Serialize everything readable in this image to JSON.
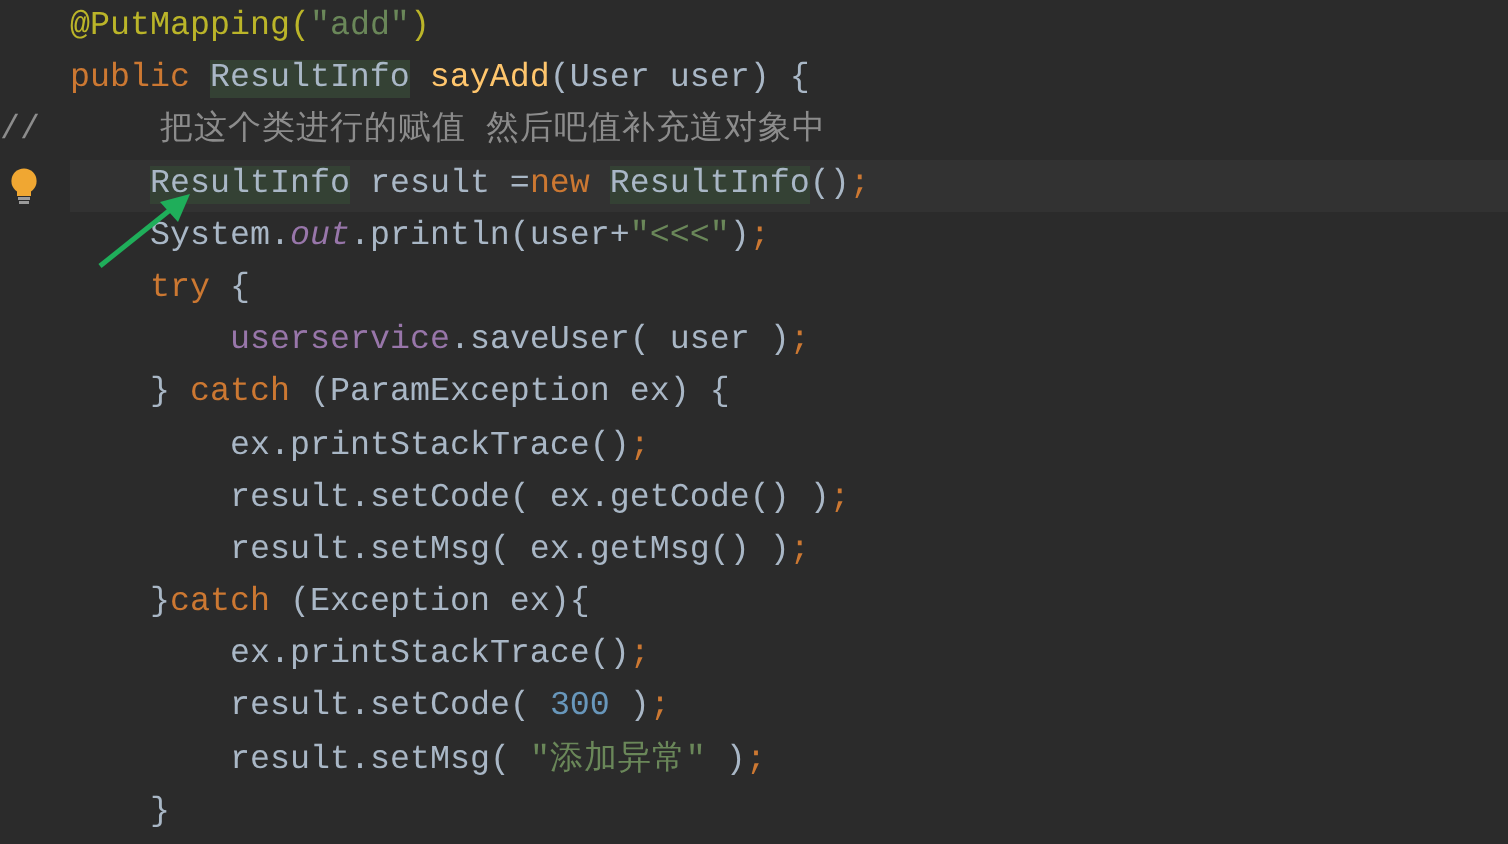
{
  "editor": {
    "lines": [
      {
        "kind": "code",
        "tokens": [
          {
            "kind": "annotation",
            "text": "@PutMapping("
          },
          {
            "kind": "string",
            "text": "\"add\""
          },
          {
            "kind": "annotation",
            "text": ")"
          }
        ]
      },
      {
        "kind": "code",
        "tokens": [
          {
            "kind": "keyword",
            "text": "public "
          },
          {
            "kind": "type_highlight",
            "text": "ResultInfo"
          },
          {
            "kind": "method_decl",
            "text": " sayAdd"
          },
          {
            "kind": "plain",
            "text": "(User user) {"
          }
        ],
        "children": [
          {
            "kind": "line_comment",
            "tokens": [
              {
                "kind": "comment",
                "text": "//      把这个类进行的赋值 然后吧值补充道对象中"
              }
            ]
          },
          {
            "kind": "code",
            "current": true,
            "intention": true,
            "tokens": [
              {
                "kind": "type_highlight",
                "text": "ResultInfo"
              },
              {
                "kind": "plain",
                "text": " result ="
              },
              {
                "kind": "keyword",
                "text": "new "
              },
              {
                "kind": "type_highlight",
                "text": "ResultInfo"
              },
              {
                "kind": "plain",
                "text": "()"
              },
              {
                "kind": "keyword",
                "text": ";"
              }
            ]
          },
          {
            "kind": "code",
            "tokens": [
              {
                "kind": "plain",
                "text": "System."
              },
              {
                "kind": "static_field",
                "text": "out"
              },
              {
                "kind": "plain",
                "text": ".println(user+"
              },
              {
                "kind": "string",
                "text": "\"<<<\""
              },
              {
                "kind": "plain",
                "text": ")"
              },
              {
                "kind": "keyword",
                "text": ";"
              }
            ]
          },
          {
            "kind": "code",
            "tokens": [
              {
                "kind": "keyword",
                "text": "try"
              },
              {
                "kind": "plain",
                "text": " {"
              }
            ],
            "children": [
              {
                "kind": "code",
                "tokens": [
                  {
                    "kind": "field",
                    "text": "userservice"
                  },
                  {
                    "kind": "plain",
                    "text": ".saveUser( user )"
                  },
                  {
                    "kind": "keyword",
                    "text": ";"
                  }
                ]
              }
            ]
          },
          {
            "kind": "code",
            "tokens": [
              {
                "kind": "plain",
                "text": "} "
              },
              {
                "kind": "keyword",
                "text": "catch"
              },
              {
                "kind": "plain",
                "text": " (ParamException ex) {"
              }
            ],
            "children": [
              {
                "kind": "code",
                "tokens": [
                  {
                    "kind": "plain",
                    "text": "ex.printStackTrace()"
                  },
                  {
                    "kind": "keyword",
                    "text": ";"
                  }
                ]
              },
              {
                "kind": "code",
                "tokens": [
                  {
                    "kind": "plain",
                    "text": "result.setCode( ex.getCode() )"
                  },
                  {
                    "kind": "keyword",
                    "text": ";"
                  }
                ]
              },
              {
                "kind": "code",
                "tokens": [
                  {
                    "kind": "plain",
                    "text": "result.setMsg( ex.getMsg() )"
                  },
                  {
                    "kind": "keyword",
                    "text": ";"
                  }
                ]
              }
            ]
          },
          {
            "kind": "code",
            "tokens": [
              {
                "kind": "plain",
                "text": "}"
              },
              {
                "kind": "keyword",
                "text": "catch"
              },
              {
                "kind": "plain",
                "text": " (Exception ex){"
              }
            ],
            "children": [
              {
                "kind": "code",
                "tokens": [
                  {
                    "kind": "plain",
                    "text": "ex.printStackTrace()"
                  },
                  {
                    "kind": "keyword",
                    "text": ";"
                  }
                ]
              },
              {
                "kind": "code",
                "tokens": [
                  {
                    "kind": "plain",
                    "text": "result.setCode( "
                  },
                  {
                    "kind": "number",
                    "text": "300"
                  },
                  {
                    "kind": "plain",
                    "text": " )"
                  },
                  {
                    "kind": "keyword",
                    "text": ";"
                  }
                ]
              },
              {
                "kind": "code",
                "tokens": [
                  {
                    "kind": "plain",
                    "text": "result.setMsg( "
                  },
                  {
                    "kind": "string",
                    "text": "\"添加异常\""
                  },
                  {
                    "kind": "plain",
                    "text": " )"
                  },
                  {
                    "kind": "keyword",
                    "text": ";"
                  }
                ]
              }
            ]
          },
          {
            "kind": "code",
            "tokens": [
              {
                "kind": "plain",
                "text": "}"
              }
            ]
          }
        ]
      }
    ]
  }
}
